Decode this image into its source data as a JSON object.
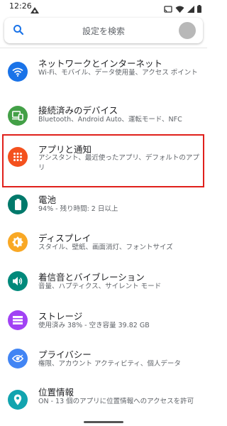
{
  "status_bar": {
    "time": "12:26",
    "icons": [
      "notification-icon",
      "cast-icon",
      "wifi-icon",
      "signal-icon",
      "battery-icon"
    ]
  },
  "search": {
    "placeholder": "設定を検索"
  },
  "colors": {
    "network": "#1a73e8",
    "devices": "#43a047",
    "apps": "#f4511e",
    "battery": "#00796b",
    "display": "#f9a825",
    "sound": "#00897b",
    "storage": "#a142f4",
    "privacy": "#4285f4",
    "location": "#12a4af",
    "highlight": "#e0201b"
  },
  "items": [
    {
      "title": "ネットワークとインターネット",
      "subtitle": "Wi-Fi、モバイル、データ使用量、アクセス ポイント",
      "icon": "wifi-icon"
    },
    {
      "title": "接続済みのデバイス",
      "subtitle": "Bluetooth、Android Auto、運転モード、NFC",
      "icon": "devices-icon"
    },
    {
      "title": "アプリと通知",
      "subtitle": "アシスタント、最近使ったアプリ、デフォルトのアプリ",
      "icon": "apps-grid-icon"
    },
    {
      "title": "電池",
      "subtitle": "94% - 残り時間: 2 日以上",
      "icon": "battery-icon"
    },
    {
      "title": "ディスプレイ",
      "subtitle": "スタイル、壁紙、画面消灯、フォントサイズ",
      "icon": "brightness-icon"
    },
    {
      "title": "着信音とバイブレーション",
      "subtitle": "音量、ハプティクス、サイレント モード",
      "icon": "volume-icon"
    },
    {
      "title": "ストレージ",
      "subtitle": "使用済み 38% - 空き容量 39.82 GB",
      "icon": "storage-icon"
    },
    {
      "title": "プライバシー",
      "subtitle": "権限、アカウント アクティビティ、個人データ",
      "icon": "privacy-eye-icon"
    },
    {
      "title": "位置情報",
      "subtitle": "ON - 13 個のアプリに位置情報へのアクセスを許可",
      "icon": "location-pin-icon"
    }
  ]
}
